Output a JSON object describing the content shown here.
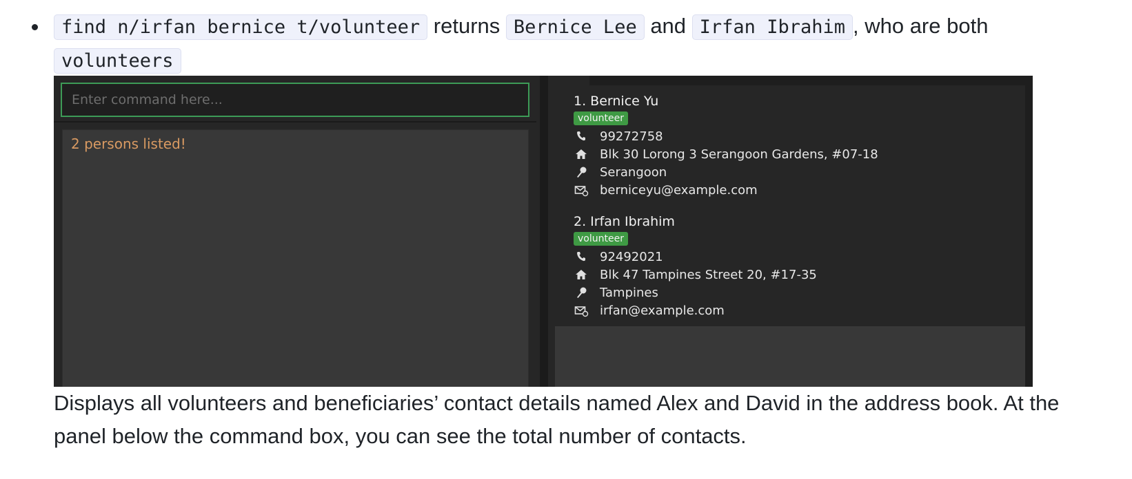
{
  "bullet": {
    "code1": "find n/irfan bernice t/volunteer",
    "text1": " returns ",
    "code2": "Bernice Lee",
    "text2": " and ",
    "code3": "Irfan Ibrahim",
    "text3": ", who are both ",
    "code4": "volunteers"
  },
  "app": {
    "command_placeholder": "Enter command here...",
    "result_message": "2 persons listed!",
    "persons": [
      {
        "name": "1. Bernice Yu",
        "tag": "volunteer",
        "phone": "99272758",
        "address": "Blk 30 Lorong 3 Serangoon Gardens, #07-18",
        "area": "Serangoon",
        "email": "berniceyu@example.com"
      },
      {
        "name": "2. Irfan Ibrahim",
        "tag": "volunteer",
        "phone": "92492021",
        "address": "Blk 47 Tampines Street 20, #17-35",
        "area": "Tampines",
        "email": "irfan@example.com"
      }
    ],
    "icons": [
      "phone-icon",
      "home-icon",
      "pin-icon",
      "mail-icon"
    ],
    "colors": {
      "tag": "#3f9a44",
      "result_text": "#d99a62",
      "focus_border": "#3d9b57"
    }
  },
  "description": "Displays all volunteers and beneficiaries’ contact details named Alex and David in the address book. At the panel below the command box, you can see the total number of contacts."
}
